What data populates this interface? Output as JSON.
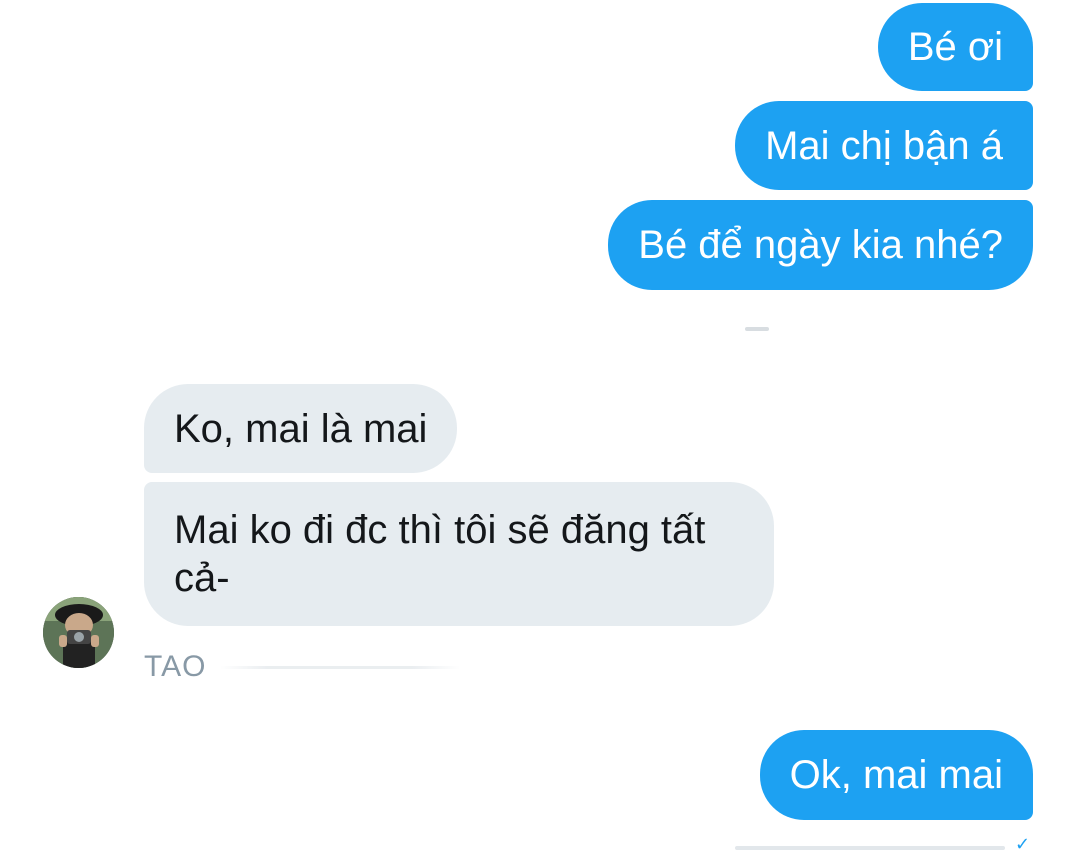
{
  "conversation": {
    "outgoing_1": {
      "messages": [
        "Bé ơi",
        "Mai chị bận á",
        "Bé để ngày kia nhé?"
      ]
    },
    "incoming": {
      "sender": "TAO",
      "avatar_icon": "user-avatar-icon",
      "messages": [
        "Ko, mai là mai",
        "Mai ko đi đc thì tôi sẽ đăng tất cả-"
      ]
    },
    "outgoing_2": {
      "messages": [
        "Ok, mai mai"
      ]
    }
  },
  "colors": {
    "outgoing_bubble": "#1da1f2",
    "incoming_bubble": "#e6ecf0",
    "sender_label": "#8899a6"
  }
}
